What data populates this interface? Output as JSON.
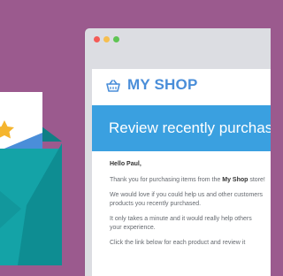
{
  "colors": {
    "background": "#9b5a8e",
    "browser_chrome": "#dcdde2",
    "brand_blue": "#4a8ed9",
    "banner": "#3aa0e0",
    "star": "#f5b52e",
    "envelope_teal": "#14a3a7"
  },
  "browser": {
    "dots": [
      "#f45b56",
      "#f6be4f",
      "#5fc453"
    ],
    "back_icon": "arrow-left-icon",
    "forward_icon": "arrow-right-icon",
    "reload_icon": "reload-icon"
  },
  "email": {
    "logo_icon": "basket-icon",
    "shop_name": "MY SHOP",
    "banner_title": "Review recently purchased products",
    "greeting": "Hello Paul,",
    "p1_prefix": "Thank you for purchasing items from the ",
    "p1_shop": "My Shop",
    "p1_suffix": " store!",
    "p2_line1": "We would love if you could help us and other customers",
    "p2_line2": "products you recently purchased.",
    "p3_line1": "It only takes a minute and it would really help others",
    "p3_line2": "your experience.",
    "p4_line1": "Click the link below for each product and review it"
  },
  "envelope": {
    "star_icon": "star-icon",
    "envelope_icon": "envelope-icon"
  }
}
